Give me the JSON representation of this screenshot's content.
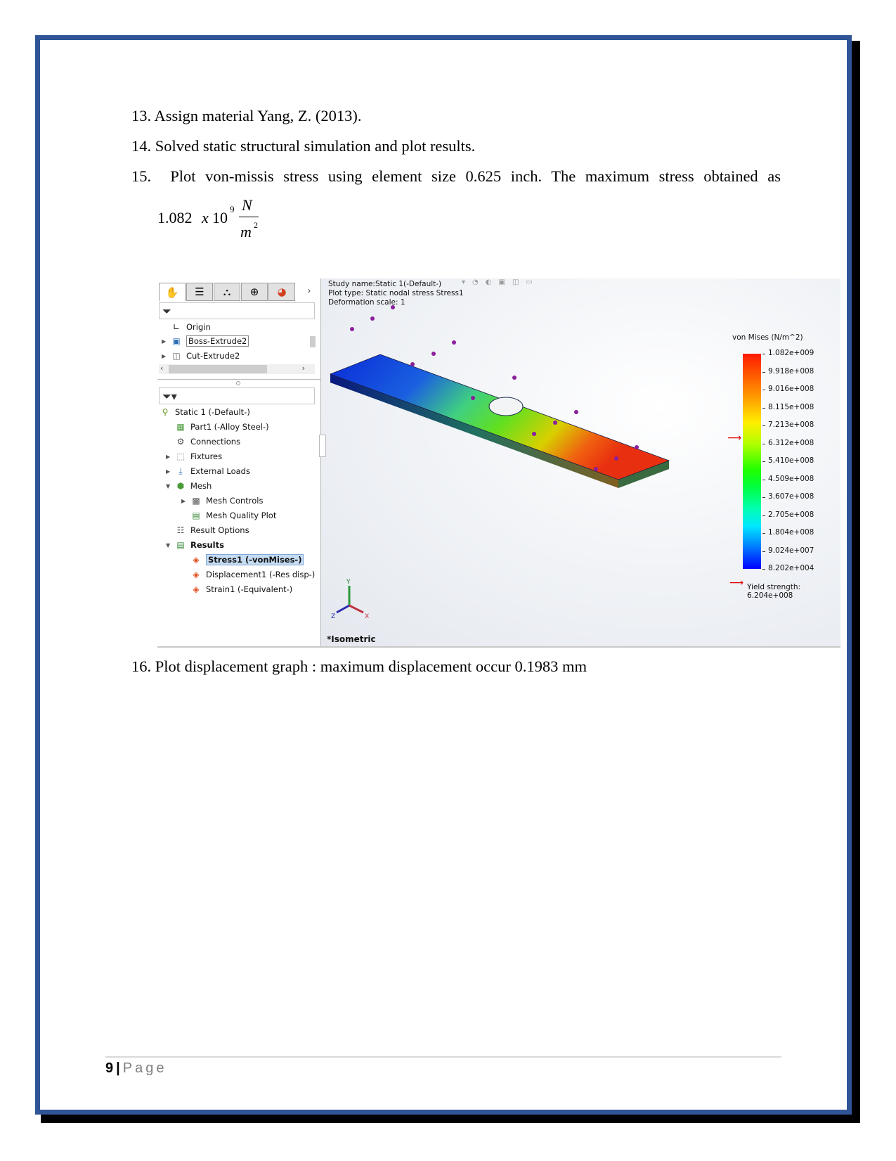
{
  "document": {
    "items": [
      {
        "number": "13.",
        "text": "Assign material Yang, Z. (2013)."
      },
      {
        "number": "14.",
        "text": "Solved static structural simulation and plot results."
      },
      {
        "number": "15.",
        "text": "Plot von-missis stress using element size 0.625 inch. The maximum stress obtained as"
      },
      {
        "number": "16.",
        "text": "Plot displacement graph : maximum displacement occur 0.1983 mm"
      }
    ],
    "formula": {
      "mantissa": "1.082",
      "times": "x",
      "base": "10",
      "exponent": "9",
      "numerator": "N",
      "denominator": "m",
      "denominator_exponent": "2"
    },
    "footer": {
      "page_number": "9",
      "separator": "|",
      "page_label": "Page"
    }
  },
  "screenshot": {
    "panel": {
      "tabs": [
        "feature-manager",
        "property-manager",
        "configuration-manager",
        "dimxpert-manager",
        "display-manager"
      ],
      "tabs_chevron": "›",
      "feature_tree": [
        {
          "label": "Origin",
          "expandable": false
        },
        {
          "label": "Boss-Extrude2",
          "expandable": true
        },
        {
          "label": "Cut-Extrude2",
          "expandable": true
        }
      ],
      "study_tree": [
        {
          "label": "Static 1 (-Default-)",
          "level": 0
        },
        {
          "label": "Part1 (-Alloy Steel-)",
          "level": 1
        },
        {
          "label": "Connections",
          "level": 1
        },
        {
          "label": "Fixtures",
          "level": 1,
          "expandable": true
        },
        {
          "label": "External Loads",
          "level": 1,
          "expandable": true
        },
        {
          "label": "Mesh",
          "level": 1,
          "expanded": true
        },
        {
          "label": "Mesh Controls",
          "level": 2,
          "expandable": true
        },
        {
          "label": "Mesh Quality Plot",
          "level": 2
        },
        {
          "label": "Result Options",
          "level": 1
        },
        {
          "label": "Results",
          "level": 1,
          "expanded": true
        },
        {
          "label": "Stress1 (-vonMises-)",
          "level": 2,
          "selected": true
        },
        {
          "label": "Displacement1 (-Res disp-)",
          "level": 2
        },
        {
          "label": "Strain1 (-Equivalent-)",
          "level": 2
        }
      ]
    },
    "viewport": {
      "study_name": "Study name:Static 1(-Default-)",
      "plot_type": "Plot type: Static nodal stress Stress1",
      "deformation_scale": "Deformation scale: 1",
      "legend_title": "von Mises (N/m^2)",
      "legend_ticks": [
        "1.082e+009",
        "9.918e+008",
        "9.016e+008",
        "8.115e+008",
        "7.213e+008",
        "6.312e+008",
        "5.410e+008",
        "4.509e+008",
        "3.607e+008",
        "2.705e+008",
        "1.804e+008",
        "9.024e+007",
        "8.202e+004"
      ],
      "yield_strength": "Yield strength: 6.204e+008",
      "view_label": "*Isometric",
      "axes": {
        "x": "X",
        "y": "Y",
        "z": "Z"
      },
      "colors": {
        "max": "#ff1a00",
        "mid": "#20ff00",
        "min": "#0000ff",
        "marker": "#8a1f9c",
        "yield_arrow": "#dd0000"
      }
    }
  }
}
